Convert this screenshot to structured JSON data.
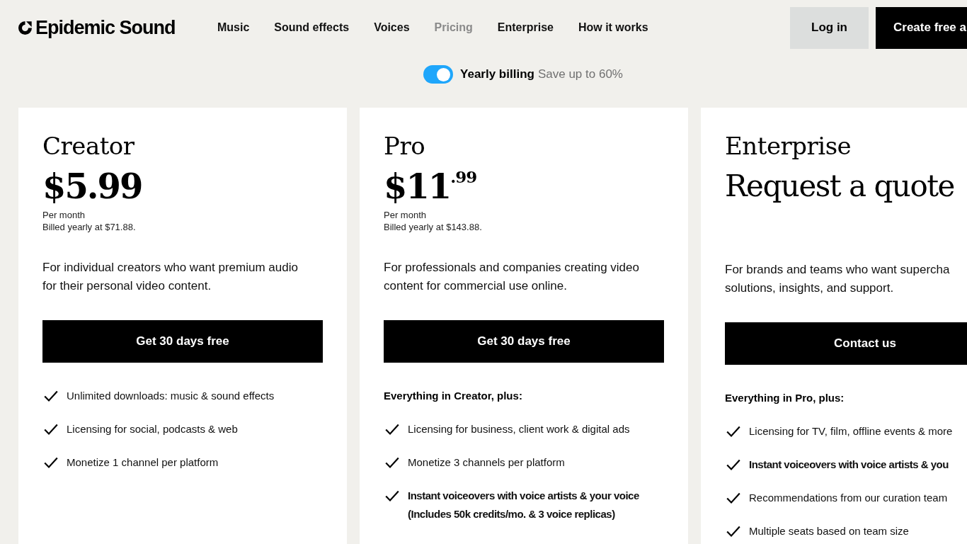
{
  "header": {
    "logo": "Epidemic Sound",
    "nav": [
      {
        "label": "Music",
        "selected": false
      },
      {
        "label": "Sound effects",
        "selected": false
      },
      {
        "label": "Voices",
        "selected": false
      },
      {
        "label": "Pricing",
        "selected": true
      },
      {
        "label": "Enterprise",
        "selected": false
      },
      {
        "label": "How it works",
        "selected": false
      }
    ],
    "login": "Log in",
    "signup": "Create free a"
  },
  "billing": {
    "on": true,
    "label": "Yearly billing",
    "note": "Save up to 60%"
  },
  "plans": [
    {
      "name": "Creator",
      "kind": "price",
      "price": "$5.99",
      "period": "Per month",
      "billed": "Billed yearly at $71.88.",
      "description": [
        "For individual creators who want premium audio",
        "for their personal video content."
      ],
      "button": "Get 30 days free",
      "features": [
        {
          "text": "Unlimited downloads: music & sound effects",
          "bold": false
        },
        {
          "text": "Licensing for social, podcasts & web",
          "bold": false
        },
        {
          "text": "Monetize 1 channel per platform",
          "bold": false
        }
      ]
    },
    {
      "name": "Pro",
      "kind": "price",
      "price": "$11$^{.99}$",
      "period": "Per month",
      "billed": "Billed yearly at $143.88.",
      "description": [
        "For professionals and companies creating video",
        "content for commercial use online."
      ],
      "button": "Get 30 days free",
      "features_heading": "Everything in Creator, plus:",
      "features": [
        {
          "text": "Licensing for business, client work & digital ads",
          "bold": false
        },
        {
          "text": "Monetize 3 channels per platform",
          "bold": false
        },
        {
          "text": "Instant voiceovers with voice artists & your voice (Includes 50k credits/mo. & 3 voice replicas)",
          "bold": true
        }
      ]
    },
    {
      "name": "Enterprise",
      "kind": "quote",
      "price": "Request a quote",
      "description": [
        "For brands and teams who want supercha",
        "solutions, insights, and support."
      ],
      "button": "Contact us",
      "features_heading": "Everything in Pro, plus:",
      "features": [
        {
          "text": "Licensing for TV, film, offline events & more",
          "bold": false
        },
        {
          "text": "Instant voiceovers with voice artists & you",
          "bold": true
        },
        {
          "text": "Recommendations from our curation team",
          "bold": false
        },
        {
          "text": "Multiple seats based on team size",
          "bold": false
        }
      ]
    }
  ]
}
